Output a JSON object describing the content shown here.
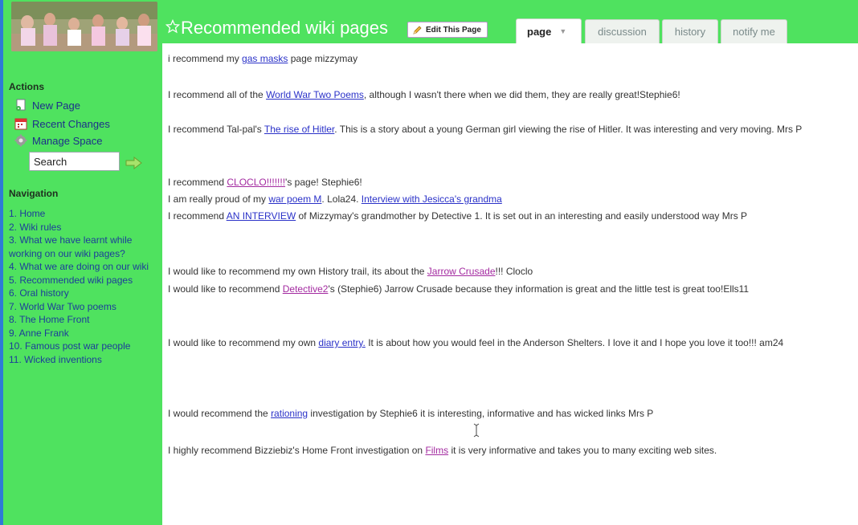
{
  "sidebar": {
    "actions_heading": "Actions",
    "actions": [
      {
        "label": "New Page",
        "icon": "new-page-icon"
      },
      {
        "label": "Recent Changes",
        "icon": "calendar-icon"
      },
      {
        "label": "Manage Space",
        "icon": "gear-icon"
      }
    ],
    "search_value": "Search",
    "navigation_heading": "Navigation",
    "nav_items": [
      "1. Home",
      "2. Wiki rules",
      "3. What we have learnt while working on our wiki pages?",
      "4. What we are doing on our wiki",
      "5. Recommended wiki pages",
      "6. Oral history",
      "7. World War Two poems",
      "8. The Home Front",
      "9. Anne Frank",
      "10. Famous post war people",
      "11. Wicked inventions"
    ]
  },
  "header": {
    "title": "Recommended wiki pages",
    "edit_button": "Edit This Page",
    "tabs": {
      "page": "page",
      "discussion": "discussion",
      "history": "history",
      "notify": "notify me"
    }
  },
  "content": {
    "p1": {
      "pre": "i recommend my ",
      "link": "gas masks",
      "post": " page mizzymay"
    },
    "p2": {
      "pre": "I recommend all of the ",
      "link": "World War Two Poems",
      "post": ", although I wasn't there when we did them, they are really great!Stephie6!"
    },
    "p3": {
      "pre": "I recommend Tal-pal's ",
      "link": "The rise of Hitler",
      "post": ". This is a story about a young German girl viewing the rise of Hitler. It was interesting and very moving. Mrs P"
    },
    "p4": {
      "pre": "I recommend ",
      "link": "CLOCLO!!!!!!!",
      "post": "'s page! Stephie6!"
    },
    "p5": {
      "pre": "I am really proud of my ",
      "link": "war poem M",
      "mid": ". Lola24. ",
      "link2": "Interview with Jesicca's grandma"
    },
    "p6": {
      "pre": "I recommend ",
      "link": "AN INTERVIEW",
      "post": " of Mizzymay's grandmother by Detective 1. It is set out in an interesting and easily understood way Mrs P"
    },
    "p7": {
      "pre": "I would like to recommend my own History trail, its about the ",
      "link": "Jarrow Crusade",
      "post": "!!! Cloclo"
    },
    "p8": {
      "pre": "I would like to recommend ",
      "link": "Detective2",
      "post": "'s (Stephie6) Jarrow Crusade because they information is great and the little test is great too!Ells11"
    },
    "p9": {
      "pre": "I would like to recommend my own ",
      "link": "diary entry.",
      "post": " It is about how you would feel in the Anderson Shelters. I love it and I hope you love it too!!! am24"
    },
    "p10": {
      "pre": "I would recommend the ",
      "link": "rationing",
      "post": " investigation by Stephie6 it is interesting, informative and has wicked links Mrs P"
    },
    "p11": {
      "pre": "I highly recommend Bizziebiz's Home Front investigation on ",
      "link": "Films",
      "post": " it is very informative and takes you to many exciting web sites."
    }
  },
  "colors": {
    "sidebar_green": "#4fe25f",
    "link_blue": "#2a31c8",
    "link_visited": "#a32aa0",
    "title_white": "#ffffff"
  }
}
